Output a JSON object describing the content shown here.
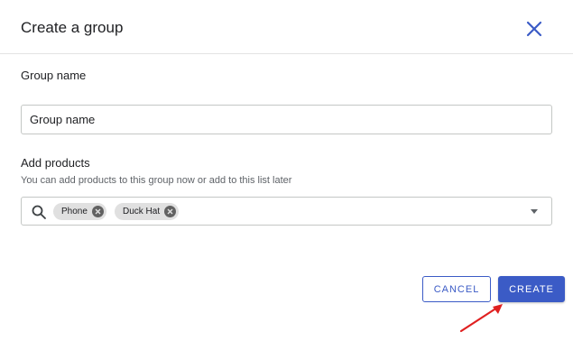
{
  "dialog": {
    "title": "Create a group",
    "close_icon": "close-icon"
  },
  "group_name": {
    "label": "Group name",
    "value": "Group name"
  },
  "add_products": {
    "label": "Add products",
    "helper": "You can add products to this group now or add to this list later",
    "search_icon": "search-icon",
    "chips": [
      {
        "label": "Phone"
      },
      {
        "label": "Duck Hat"
      }
    ],
    "dropdown_icon": "dropdown-arrow-icon"
  },
  "actions": {
    "cancel_label": "CANCEL",
    "create_label": "CREATE"
  },
  "colors": {
    "accent": "#3b5bc6",
    "annotation": "#e02020"
  }
}
